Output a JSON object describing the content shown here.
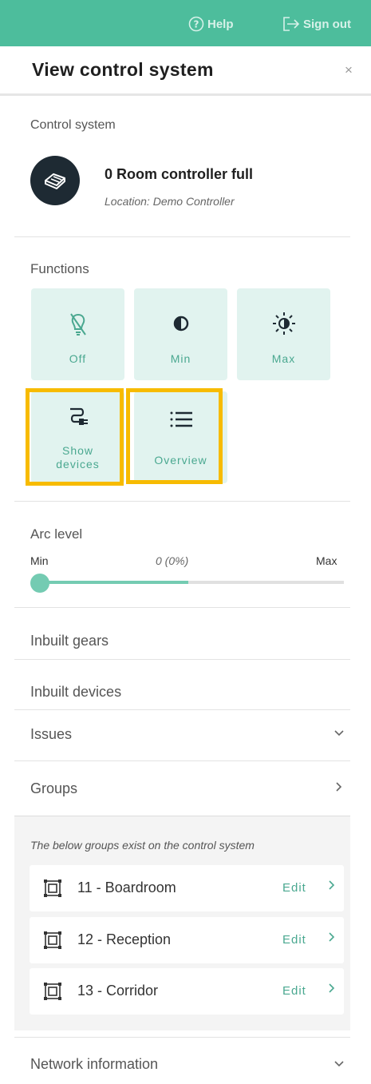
{
  "topbar": {
    "help_label": "Help",
    "signout_label": "Sign out"
  },
  "panel": {
    "title": "View control system",
    "close_icon": "×"
  },
  "control_system": {
    "section_label": "Control system",
    "name": "0 Room controller full",
    "location": "Location: Demo Controller",
    "icon": "controller-icon"
  },
  "functions": {
    "title": "Functions",
    "buttons": [
      {
        "label": "Off",
        "icon": "bulb-off-icon"
      },
      {
        "label": "Min",
        "icon": "half-circle-icon"
      },
      {
        "label": "Max",
        "icon": "sun-icon"
      },
      {
        "label": "Show devices",
        "line1": "Show",
        "line2": "devices",
        "icon": "plug-icon"
      },
      {
        "label": "Overview",
        "icon": "list-icon"
      }
    ],
    "highlight_color": "#f7bb00"
  },
  "arc_level": {
    "title": "Arc level",
    "min_label": "Min",
    "max_label": "Max",
    "value_text": "0 (0%)",
    "value": 0
  },
  "sections": {
    "inbuilt_gears": "Inbuilt gears",
    "inbuilt_devices": "Inbuilt devices",
    "issues": "Issues",
    "groups": "Groups",
    "network_information": "Network information"
  },
  "groups": {
    "note": "The below groups exist on the control system",
    "edit_label": "Edit",
    "items": [
      {
        "name": "11 - Boardroom"
      },
      {
        "name": "12 - Reception"
      },
      {
        "name": "13 - Corridor"
      }
    ]
  },
  "colors": {
    "header": "#4dbd9c",
    "accent": "#4aa890",
    "button_bg": "#e1f3ef"
  }
}
